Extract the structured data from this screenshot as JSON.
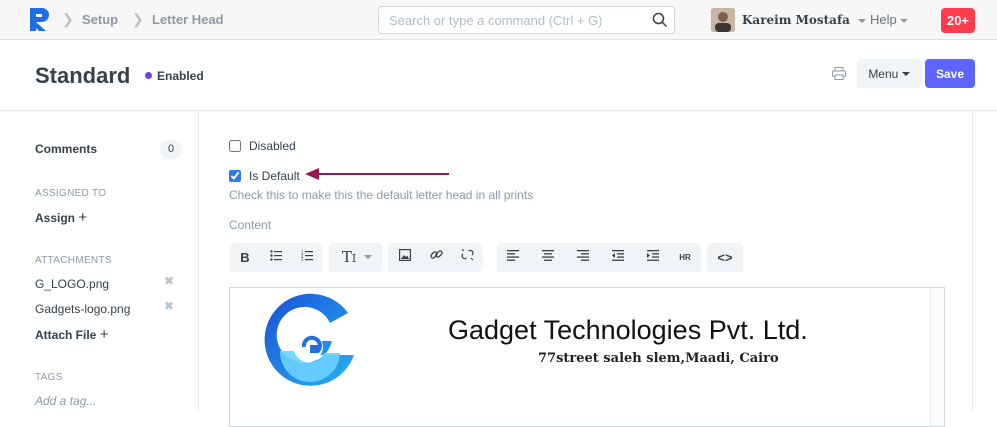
{
  "colors": {
    "accent": "#5e64ff",
    "indicator": "#743ee2",
    "notification": "#ff3b4e",
    "arrow": "#9a1750",
    "logo": "#1f6fe0"
  },
  "navbar": {
    "breadcrumbs": [
      "Setup",
      "Letter Head"
    ],
    "search_placeholder": "Search or type a command (Ctrl + G)",
    "user_name": "Kareim Mostafa",
    "help_label": "Help",
    "notification_count": "20+"
  },
  "page": {
    "title": "Standard",
    "status": "Enabled",
    "menu_label": "Menu",
    "save_label": "Save"
  },
  "sidebar": {
    "comments_label": "Comments",
    "comments_count": "0",
    "assigned_heading": "ASSIGNED TO",
    "assign_label": "Assign",
    "attachments_heading": "ATTACHMENTS",
    "attachments": [
      "G_LOGO.png",
      "Gadgets-logo.png"
    ],
    "attach_label": "Attach File",
    "tags_heading": "TAGS",
    "tag_placeholder": "Add a tag..."
  },
  "form": {
    "disabled_label": "Disabled",
    "disabled_checked": false,
    "is_default_label": "Is Default",
    "is_default_checked": true,
    "is_default_help": "Check this to make this the default letter head in all prints",
    "content_label": "Content"
  },
  "toolbar": {
    "bold": "B",
    "font_size": "T",
    "hr": "HR"
  },
  "letterhead": {
    "company": "Gadget Technologies Pvt. Ltd.",
    "address": "77street saleh slem,Maadi, Cairo"
  }
}
